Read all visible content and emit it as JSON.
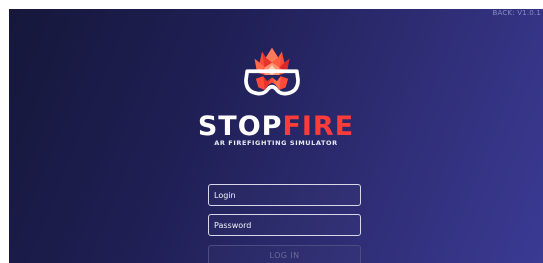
{
  "app": {
    "brand_prefix": "STOP",
    "brand_suffix": "FIRE",
    "tagline": "AR FIREFIGHTING SIMULATOR",
    "version": "BACK: V1.0.1"
  },
  "login_form": {
    "login_placeholder": "Login",
    "password_placeholder": "Password",
    "submit_label": "LOG IN"
  },
  "colors": {
    "background_start": "#16173a",
    "background_end": "#3b3a94",
    "brand_accent": "#ff3b3b",
    "logo_frame": "#ffffff",
    "flame": "#ff4b3a"
  },
  "icons": {
    "logo": "flame-in-ar-goggles-icon"
  }
}
